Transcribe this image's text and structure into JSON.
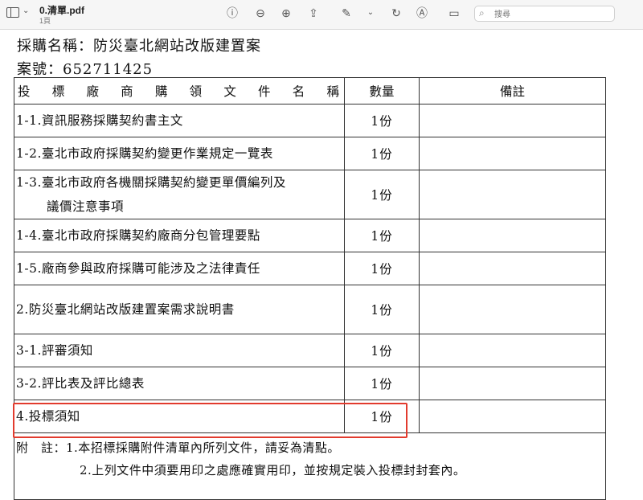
{
  "toolbar": {
    "file_name": "0.清單.pdf",
    "page_info": "1頁",
    "search_placeholder": "搜尋",
    "icons": [
      "sidebar-icon",
      "chevron-down-icon",
      "info-icon",
      "zoom-out-icon",
      "zoom-in-icon",
      "share-icon",
      "highlight-pen-icon",
      "rotate-icon",
      "markup-icon",
      "signature-icon",
      "search-icon"
    ]
  },
  "document": {
    "purchase_name_label": "採購名稱：防災臺北網站改版建置案",
    "case_number_label": "案號：652711425",
    "table": {
      "headers": {
        "name_chars": [
          "投",
          "標",
          "廠",
          "商",
          "購",
          "領",
          "文",
          "件",
          "名",
          "稱"
        ],
        "quantity": "數量",
        "remarks": "備註"
      },
      "rows": [
        {
          "lines": [
            "1-1.資訊服務採購契約書主文"
          ],
          "quantity": "1份",
          "remark": ""
        },
        {
          "lines": [
            "1-2.臺北市政府採購契約變更作業規定一覽表"
          ],
          "quantity": "1份",
          "remark": ""
        },
        {
          "lines": [
            "1-3.臺北市政府各機關採購契約變更單價編列及",
            "議價注意事項"
          ],
          "quantity": "1份",
          "remark": ""
        },
        {
          "lines": [
            "1-4.臺北市政府採購契約廠商分包管理要點"
          ],
          "quantity": "1份",
          "remark": ""
        },
        {
          "lines": [
            "1-5.廠商參與政府採購可能涉及之法律責任"
          ],
          "quantity": "1份",
          "remark": ""
        },
        {
          "lines": [
            "2.防災臺北網站改版建置案需求說明書"
          ],
          "quantity": "1份",
          "remark": ""
        },
        {
          "lines": [
            "3-1.評審須知"
          ],
          "quantity": "1份",
          "remark": ""
        },
        {
          "lines": [
            "3-2.評比表及評比總表"
          ],
          "quantity": "1份",
          "remark": ""
        },
        {
          "lines": [
            "4.投標須知"
          ],
          "quantity": "1份",
          "remark": ""
        }
      ],
      "notes": {
        "line1": "附　註：1.本招標採購附件清單內所列文件，請妥為清點。",
        "line2": "2.上列文件中須要用印之處應確實用印，並按規定裝入投標封封套內。"
      }
    },
    "highlight_color": "#e23b2e"
  }
}
